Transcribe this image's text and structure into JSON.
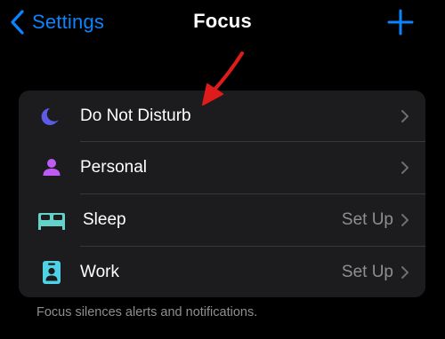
{
  "navbar": {
    "back_label": "Settings",
    "title": "Focus",
    "add_icon": "plus-icon"
  },
  "focus_modes": [
    {
      "label": "Do Not Disturb",
      "detail": "",
      "icon": "moon-icon",
      "icon_color": "#5e5ce6"
    },
    {
      "label": "Personal",
      "detail": "",
      "icon": "person-icon",
      "icon_color": "#bf5af2"
    },
    {
      "label": "Sleep",
      "detail": "Set Up",
      "icon": "bed-icon",
      "icon_color": "#64d2c8"
    },
    {
      "label": "Work",
      "detail": "Set Up",
      "icon": "id-badge-icon",
      "icon_color": "#4fd1e6"
    }
  ],
  "footer_text": "Focus silences alerts and notifications.",
  "colors": {
    "accent": "#0a84ff",
    "background": "#000000",
    "group_background": "#1c1c1e",
    "secondary_text": "#8e8e93",
    "annotation_arrow": "#e01b1b"
  }
}
